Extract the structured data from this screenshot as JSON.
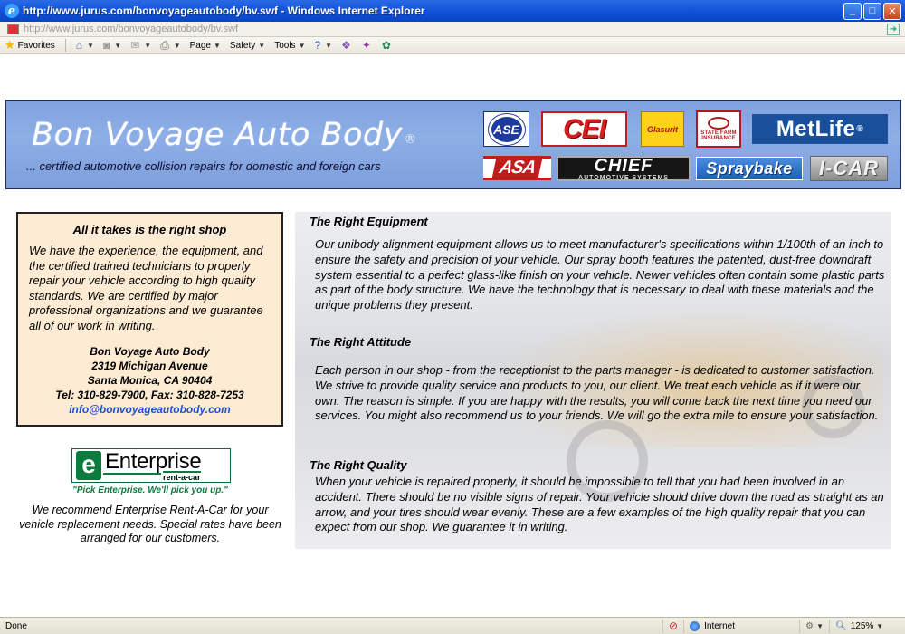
{
  "browser": {
    "title": "http://www.jurus.com/bonvoyageautobody/bv.swf - Windows Internet Explorer",
    "url": "http://www.jurus.com/bonvoyageautobody/bv.swf",
    "favorites_label": "Favorites",
    "page_label": "Page",
    "safety_label": "Safety",
    "tools_label": "Tools",
    "status": "Done",
    "zone": "Internet",
    "zoom": "125%"
  },
  "banner": {
    "brand": "Bon Voyage Auto Body",
    "registered": "®",
    "tagline": "... certified automotive collision repairs for domestic and foreign cars",
    "logos": {
      "ase": "ASE",
      "cei": "CEI",
      "glasurit": "Glasurit",
      "state_farm": "STATE FARM INSURANCE",
      "metlife": "MetLife",
      "metlife_reg": "®",
      "asa": "ASA",
      "chief": "CHIEF",
      "chief_sub": "AUTOMOTIVE SYSTEMS",
      "spraybake": "Spraybake",
      "icar": "I-CAR"
    }
  },
  "infobox": {
    "heading": "All it takes is the right shop",
    "intro": "We have the experience, the equipment, and the certified trained technicians to properly repair your vehicle according to high quality standards.  We are certified by major professional organizations and we guarantee all of our work in writing.",
    "name": "Bon Voyage Auto Body",
    "street": "2319 Michigan Avenue",
    "city": "Santa Monica, CA 90404",
    "phones": "Tel:  310-829-7900, Fax: 310-828-7253",
    "email": "info@bonvoyageautobody.com"
  },
  "enterprise": {
    "logo_word": "Enterprise",
    "logo_sub": "rent-a-car",
    "slogan": "\"Pick Enterprise. We'll pick you up.\"",
    "text": "We recommend Enterprise Rent-A-Car for your vehicle replacement needs.  Special rates have been arranged for our customers."
  },
  "sections": [
    {
      "heading": "The Right Equipment",
      "body": "Our unibody alignment equipment allows us to meet manufacturer's specifications within 1/100th of an inch to ensure the safety and precision of your vehicle.  Our spray booth features the patented, dust-free downdraft system essential to a perfect glass-like finish on your vehicle. Newer vehicles often contain some plastic parts as part of the body structure.  We have the technology that is necessary to deal with these materials and the unique problems they present."
    },
    {
      "heading": "The Right Attitude",
      "body": "Each person in our shop - from the receptionist to the parts manager - is dedicated to customer satisfaction.  We strive to provide quality service and products to you, our client.  We treat each vehicle as if it were our own.  The reason is simple.  If you are happy with the results, you will come back the next time you need our services.  You might also recommend us to your friends.  We will go the extra mile to ensure your satisfaction."
    },
    {
      "heading": "The Right Quality",
      "body": "When your vehicle is repaired properly, it should be impossible to tell that you had been involved in an accident.   There should be no visible signs of repair.  Your vehicle should drive down the road as straight as an arrow, and your tires should wear evenly.  These are a few examples of the high quality repair that you can expect from our shop.  We guarantee it in writing."
    }
  ]
}
